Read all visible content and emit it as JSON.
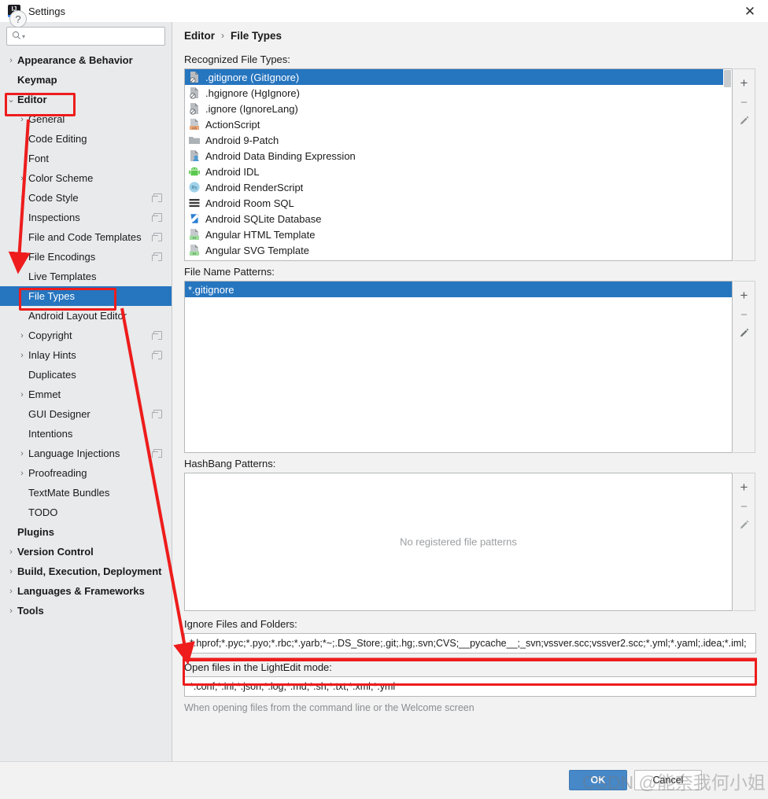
{
  "window": {
    "title": "Settings",
    "app_icon": "intellij-idea-icon",
    "close_label": "✕"
  },
  "search": {
    "icon": "search-icon",
    "value": "",
    "placeholder": ""
  },
  "sidebar": {
    "items": [
      {
        "label": "Appearance & Behavior",
        "level": 1,
        "arrow": "›",
        "bold": true,
        "selected": false,
        "badge": false
      },
      {
        "label": "Keymap",
        "level": 1,
        "arrow": "",
        "bold": true,
        "selected": false,
        "badge": false
      },
      {
        "label": "Editor",
        "level": 1,
        "arrow": "⌄",
        "bold": true,
        "selected": false,
        "badge": false
      },
      {
        "label": "General",
        "level": 2,
        "arrow": "›",
        "bold": false,
        "selected": false,
        "badge": false
      },
      {
        "label": "Code Editing",
        "level": 2,
        "arrow": "",
        "bold": false,
        "selected": false,
        "badge": false
      },
      {
        "label": "Font",
        "level": 2,
        "arrow": "",
        "bold": false,
        "selected": false,
        "badge": false
      },
      {
        "label": "Color Scheme",
        "level": 2,
        "arrow": "›",
        "bold": false,
        "selected": false,
        "badge": false
      },
      {
        "label": "Code Style",
        "level": 2,
        "arrow": "›",
        "bold": false,
        "selected": false,
        "badge": true
      },
      {
        "label": "Inspections",
        "level": 2,
        "arrow": "",
        "bold": false,
        "selected": false,
        "badge": true
      },
      {
        "label": "File and Code Templates",
        "level": 2,
        "arrow": "",
        "bold": false,
        "selected": false,
        "badge": true
      },
      {
        "label": "File Encodings",
        "level": 2,
        "arrow": "",
        "bold": false,
        "selected": false,
        "badge": true
      },
      {
        "label": "Live Templates",
        "level": 2,
        "arrow": "",
        "bold": false,
        "selected": false,
        "badge": false
      },
      {
        "label": "File Types",
        "level": 2,
        "arrow": "",
        "bold": false,
        "selected": true,
        "badge": false
      },
      {
        "label": "Android Layout Editor",
        "level": 2,
        "arrow": "",
        "bold": false,
        "selected": false,
        "badge": false
      },
      {
        "label": "Copyright",
        "level": 2,
        "arrow": "›",
        "bold": false,
        "selected": false,
        "badge": true
      },
      {
        "label": "Inlay Hints",
        "level": 2,
        "arrow": "›",
        "bold": false,
        "selected": false,
        "badge": true
      },
      {
        "label": "Duplicates",
        "level": 2,
        "arrow": "",
        "bold": false,
        "selected": false,
        "badge": false
      },
      {
        "label": "Emmet",
        "level": 2,
        "arrow": "›",
        "bold": false,
        "selected": false,
        "badge": false
      },
      {
        "label": "GUI Designer",
        "level": 2,
        "arrow": "",
        "bold": false,
        "selected": false,
        "badge": true
      },
      {
        "label": "Intentions",
        "level": 2,
        "arrow": "",
        "bold": false,
        "selected": false,
        "badge": false
      },
      {
        "label": "Language Injections",
        "level": 2,
        "arrow": "›",
        "bold": false,
        "selected": false,
        "badge": true
      },
      {
        "label": "Proofreading",
        "level": 2,
        "arrow": "›",
        "bold": false,
        "selected": false,
        "badge": false
      },
      {
        "label": "TextMate Bundles",
        "level": 2,
        "arrow": "",
        "bold": false,
        "selected": false,
        "badge": false
      },
      {
        "label": "TODO",
        "level": 2,
        "arrow": "",
        "bold": false,
        "selected": false,
        "badge": false
      },
      {
        "label": "Plugins",
        "level": 1,
        "arrow": "",
        "bold": true,
        "selected": false,
        "badge": false
      },
      {
        "label": "Version Control",
        "level": 1,
        "arrow": "›",
        "bold": true,
        "selected": false,
        "badge": false
      },
      {
        "label": "Build, Execution, Deployment",
        "level": 1,
        "arrow": "›",
        "bold": true,
        "selected": false,
        "badge": false
      },
      {
        "label": "Languages & Frameworks",
        "level": 1,
        "arrow": "›",
        "bold": true,
        "selected": false,
        "badge": false
      },
      {
        "label": "Tools",
        "level": 1,
        "arrow": "›",
        "bold": true,
        "selected": false,
        "badge": false
      }
    ]
  },
  "breadcrumb": {
    "parent": "Editor",
    "separator": "›",
    "current": "File Types"
  },
  "recognized": {
    "label": "Recognized File Types:",
    "items": [
      {
        "name": ".gitignore (GitIgnore)",
        "icon": "ignore-file-icon",
        "selected": true
      },
      {
        "name": ".hgignore (HgIgnore)",
        "icon": "ignore-file-icon",
        "selected": false
      },
      {
        "name": ".ignore (IgnoreLang)",
        "icon": "ignore-file-icon",
        "selected": false
      },
      {
        "name": "ActionScript",
        "icon": "actionscript-file-icon",
        "selected": false
      },
      {
        "name": "Android 9-Patch",
        "icon": "folder-icon",
        "selected": false
      },
      {
        "name": "Android Data Binding Expression",
        "icon": "data-binding-icon",
        "selected": false
      },
      {
        "name": "Android IDL",
        "icon": "android-robot-icon",
        "selected": false
      },
      {
        "name": "Android RenderScript",
        "icon": "renderscript-icon",
        "selected": false
      },
      {
        "name": "Android Room SQL",
        "icon": "room-sql-icon",
        "selected": false
      },
      {
        "name": "Android SQLite Database",
        "icon": "sqlite-db-icon",
        "selected": false
      },
      {
        "name": "Angular HTML Template",
        "icon": "angular-html-icon",
        "selected": false
      },
      {
        "name": "Angular SVG Template",
        "icon": "angular-svg-icon",
        "selected": false
      }
    ],
    "buttons": [
      {
        "name": "add",
        "glyph": "+"
      },
      {
        "name": "remove",
        "glyph": "−"
      },
      {
        "name": "edit",
        "glyph": "pencil"
      }
    ]
  },
  "file_name_patterns": {
    "label": "File Name Patterns:",
    "items": [
      {
        "pattern": "*.gitignore",
        "selected": true
      }
    ],
    "buttons": [
      {
        "name": "add",
        "glyph": "+"
      },
      {
        "name": "remove",
        "glyph": "−"
      },
      {
        "name": "edit",
        "glyph": "pencil"
      }
    ]
  },
  "hashbang_patterns": {
    "label": "HashBang Patterns:",
    "empty_text": "No registered file patterns",
    "items": [],
    "buttons": [
      {
        "name": "add",
        "glyph": "+"
      },
      {
        "name": "remove",
        "glyph": "−"
      },
      {
        "name": "edit",
        "glyph": "pencil"
      }
    ]
  },
  "ignore_files": {
    "label": "Ignore Files and Folders:",
    "value": "*.hprof;*.pyc;*.pyo;*.rbc;*.yarb;*~;.DS_Store;.git;.hg;.svn;CVS;__pycache__;_svn;vssver.scc;vssver2.scc;*.yml;*.yaml;.idea;*.iml;"
  },
  "lightedit": {
    "label": "Open files in the LightEdit mode:",
    "value": "*.conf;*.ini;*.json;*.log;*.md;*.sh;*.txt;*.xml;*.yml",
    "hint": "When opening files from the command line or the Welcome screen"
  },
  "footer": {
    "help_glyph": "?",
    "ok_label": "OK",
    "cancel_label": "Cancel"
  },
  "watermark": {
    "text": "CSDN @能奈我何小姐"
  },
  "colors": {
    "selection_blue": "#2675bf",
    "accent_red": "#ee1c1c",
    "ok_button": "#4688c8",
    "sidebar_bg": "#e8eaec",
    "panel_bg": "#f2f2f2"
  }
}
